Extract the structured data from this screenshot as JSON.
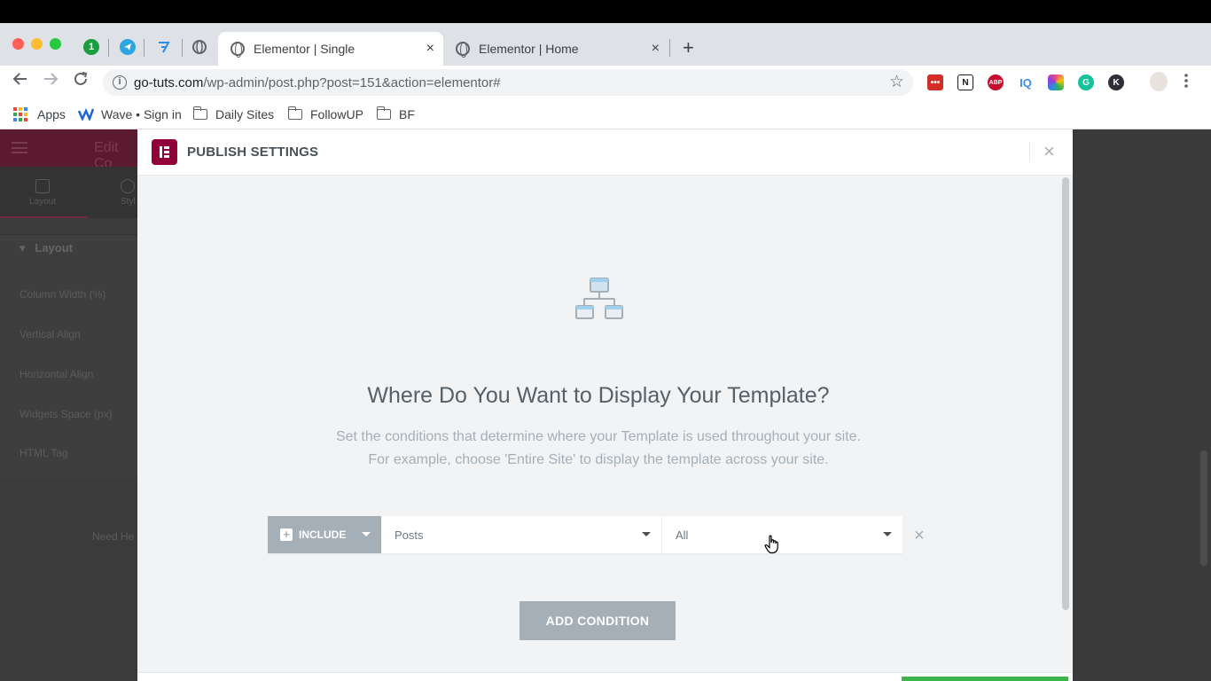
{
  "browser": {
    "tabs": [
      {
        "label": "Elementor | Single",
        "active": true
      },
      {
        "label": "Elementor | Home",
        "active": false
      }
    ],
    "new_tab_label": "+",
    "close_glyph": "×",
    "address": {
      "host": "go-tuts.com",
      "path": "/wp-admin/post.php?post=151&action=elementor#"
    },
    "pinned_tabs": [
      {
        "icon": "1password-icon",
        "label": "1",
        "color": "#1a9e3f"
      },
      {
        "icon": "telegram-icon",
        "label": "",
        "color": "#2ca5e0"
      },
      {
        "icon": "typora-icon",
        "label": "",
        "color": "#2b8ce6"
      },
      {
        "icon": "globe-icon",
        "label": "",
        "color": "#5f6368"
      }
    ],
    "extensions": [
      {
        "icon": "lastpass-icon",
        "label": "•••",
        "color": "#d32d27"
      },
      {
        "icon": "notion-icon",
        "label": "N",
        "color": "#1a1a1a"
      },
      {
        "icon": "adblock-icon",
        "label": "ABP",
        "color": "#c70d2c"
      },
      {
        "icon": "iq-icon",
        "label": "IQ",
        "color": "#3d8ee6"
      },
      {
        "icon": "colorzilla-icon",
        "label": "",
        "color": "#e94d8a"
      },
      {
        "icon": "grammarly-icon",
        "label": "G",
        "color": "#15c39a"
      },
      {
        "icon": "k-icon",
        "label": "K",
        "color": "#2f2f3a"
      }
    ],
    "bookmarks": [
      {
        "label": "Apps",
        "icon": "apps-grid-icon"
      },
      {
        "label": "Wave • Sign in",
        "icon": "wave-icon"
      },
      {
        "label": "Daily Sites",
        "icon": "folder-icon"
      },
      {
        "label": "FollowUP",
        "icon": "folder-icon"
      },
      {
        "label": "BF",
        "icon": "folder-icon"
      }
    ]
  },
  "editor_panel": {
    "title": "Edit Co",
    "tabs": [
      {
        "label": "Layout"
      },
      {
        "label": "Styl"
      }
    ],
    "section": "Layout",
    "controls": [
      {
        "label": "Column Width (%)"
      },
      {
        "label": "Vertical Align"
      },
      {
        "label": "Horizontal Align"
      },
      {
        "label": "Widgets Space (px)"
      },
      {
        "label": "HTML Tag"
      }
    ],
    "help": "Need He"
  },
  "modal": {
    "title": "PUBLISH SETTINGS",
    "close_glyph": "×",
    "heading": "Where Do You Want to Display Your Template?",
    "description_line1": "Set the conditions that determine where your Template is used throughout your site.",
    "description_line2": "For example, choose 'Entire Site' to display the template across your site.",
    "condition": {
      "type": "INCLUDE",
      "name": "Posts",
      "sub_name": "All"
    },
    "remove_glyph": "×",
    "add_condition_label": "ADD CONDITION"
  },
  "colors": {
    "elementor_brand": "#92003b",
    "muted_button": "#a4afb7",
    "save_green": "#39b54a"
  }
}
